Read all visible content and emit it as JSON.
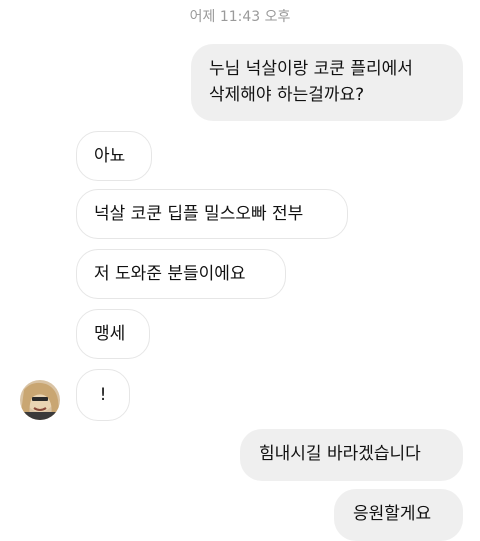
{
  "timestamp": "어제 11:43 오후",
  "messages": {
    "m1": {
      "line1": "누님 넉살이랑 코쿤 플리에서",
      "line2": "삭제해야 하는걸까요?"
    },
    "m2": "아뇨",
    "m3": "넉살 코쿤 딥플 밀스오빠 전부",
    "m4": "저 도와준 분들이에요",
    "m5": "맹세",
    "m6": "!",
    "m7": "힘내시길 바라겠습니다",
    "m8": "응원할게요"
  },
  "colors": {
    "outgoing_bubble": "#efefef",
    "incoming_border": "#e6e6e6",
    "timestamp": "#9a9a9a"
  }
}
